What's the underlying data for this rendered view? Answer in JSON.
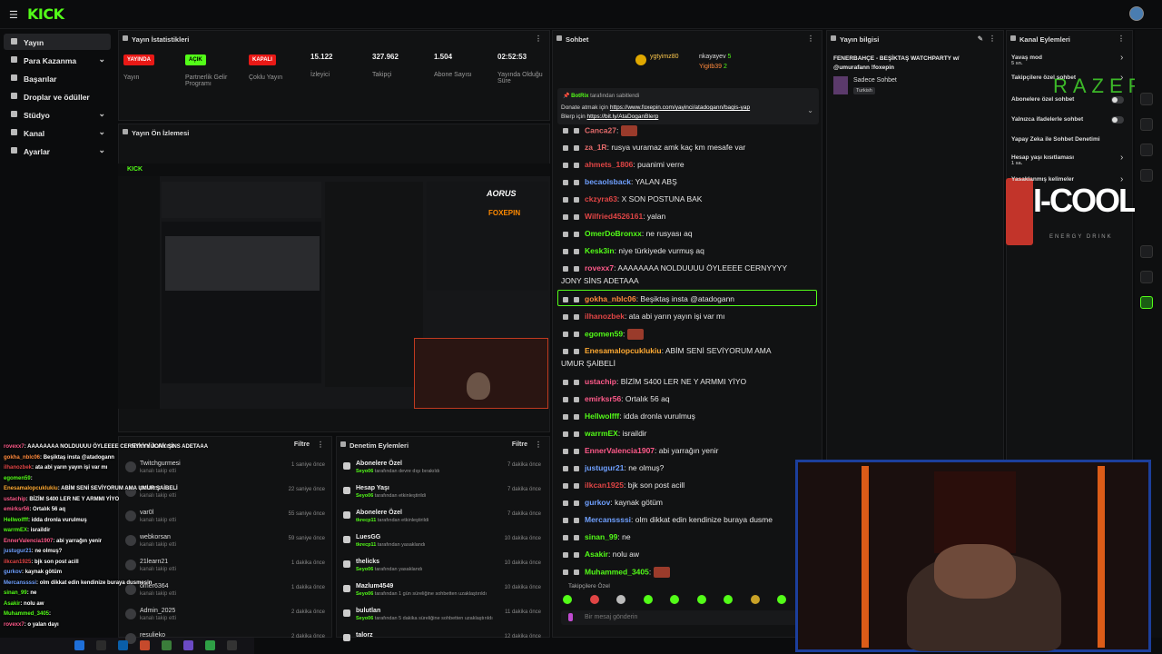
{
  "app": {
    "logo": "KICK",
    "brand_color": "#53fc18"
  },
  "sidebar": {
    "items": [
      {
        "label": "Yayın",
        "active": true,
        "chevron": ""
      },
      {
        "label": "Para Kazanma",
        "chevron": "⌄"
      },
      {
        "label": "Başarılar",
        "chevron": ""
      },
      {
        "label": "Droplar ve ödüller",
        "chevron": ""
      },
      {
        "label": "Stüdyo",
        "chevron": "⌄"
      },
      {
        "label": "Kanal",
        "chevron": "⌄"
      },
      {
        "label": "Ayarlar",
        "chevron": "⌄"
      }
    ]
  },
  "stats": {
    "title": "Yayın İstatistikleri",
    "items": [
      {
        "badge": "YAYINDA",
        "badge_color": "#e91916",
        "label": "Yayın"
      },
      {
        "badge": "AÇIK",
        "badge_color": "#53fc18",
        "label": "Partnerlik Gelir Programı"
      },
      {
        "badge": "KAPALI",
        "badge_color": "#e91916",
        "label": "Çoklu Yayın"
      },
      {
        "value": "15.122",
        "label": "İzleyici"
      },
      {
        "value": "327.962",
        "label": "Takipçi"
      },
      {
        "value": "1.504",
        "label": "Abone Sayısı"
      },
      {
        "value": "02:52:53",
        "label": "Yayında Olduğu Süre"
      }
    ]
  },
  "preview": {
    "title": "Yayın Ön İzlemesi"
  },
  "activity": {
    "title": "Etkinlik Akışı",
    "filter": "Filtre",
    "rows": [
      {
        "name": "Twitchgurmesi",
        "sub": "kanalı takip etti",
        "time": "1 saniye önce"
      },
      {
        "name": "polarez",
        "sub": "kanalı takip etti",
        "time": "22 saniye önce"
      },
      {
        "name": "var0l",
        "sub": "kanalı takip etti",
        "time": "55 saniye önce"
      },
      {
        "name": "webkorsan",
        "sub": "kanalı takip etti",
        "time": "59 saniye önce"
      },
      {
        "name": "21learn21",
        "sub": "kanalı takip etti",
        "time": "1 dakika önce"
      },
      {
        "name": "omer6364",
        "sub": "kanalı takip etti",
        "time": "1 dakika önce"
      },
      {
        "name": "Admin_2025",
        "sub": "kanalı takip etti",
        "time": "2 dakika önce"
      },
      {
        "name": "resulieko",
        "sub": "",
        "time": "2 dakika önce"
      }
    ]
  },
  "moderation": {
    "title": "Denetim Eylemleri",
    "filter": "Filtre",
    "rows": [
      {
        "name": "Abonelere Özel",
        "user": "Seyo06",
        "sub": "tarafından devre dışı bırakıldı",
        "time": "7 dakika önce"
      },
      {
        "name": "Hesap Yaşı",
        "user": "Seyo06",
        "sub": "tarafından etkinleştirildi",
        "time": "7 dakika önce"
      },
      {
        "name": "Abonelere Özel",
        "user": "tkrecp11",
        "sub": "tarafından etkinleştirildi",
        "time": "7 dakika önce"
      },
      {
        "name": "LuesGG",
        "user": "tkrecp11",
        "sub": "tarafından yasaklandı",
        "time": "10 dakika önce"
      },
      {
        "name": "thelicks",
        "user": "Seyo06",
        "sub": "tarafından yasaklandı",
        "time": "10 dakika önce"
      },
      {
        "name": "Mazlum4549",
        "user": "Seyo06",
        "sub": "tarafından 1 gün süreliğine sohbetten uzaklaştırıldı",
        "time": "10 dakika önce"
      },
      {
        "name": "bulutlan",
        "user": "Seyo06",
        "sub": "tarafından 5 dakika süreliğine sohbetten uzaklaştırıldı",
        "time": "11 dakika önce"
      },
      {
        "name": "talorz",
        "user": "",
        "sub": "",
        "time": "12 dakika önce"
      }
    ]
  },
  "chat": {
    "title": "Sohbet",
    "top_gifters": [
      {
        "name": "ygtyimz80",
        "count": ""
      },
      {
        "name": "nkayayev",
        "count": "5"
      },
      {
        "name": "Yigitb39",
        "count": "2"
      }
    ],
    "pinned": {
      "author": "BotRix",
      "by": "tarafından sabitlendi",
      "text1": "Donate atmak için",
      "link1": "https://www.foxepin.com/yayinci/atadogann/bagis-yap",
      "text2": "Blerp için",
      "link2": "https://bit.ly/AtaDoganBlerp"
    },
    "messages": [
      {
        "user": "Canca27",
        "color": "#e36b6b",
        "text": "",
        "emote": true
      },
      {
        "user": "za_1R",
        "color": "#e36b6b",
        "text": "rusya vuramaz amk kaç km mesafe var"
      },
      {
        "user": "ahmets_1806",
        "color": "#e04545",
        "text": "puanimi verre"
      },
      {
        "user": "becaolsback",
        "color": "#6fa0ff",
        "text": "YALAN ABŞ"
      },
      {
        "user": "ckzyra63",
        "color": "#e04545",
        "text": "X SON POSTUNA BAK"
      },
      {
        "user": "Wilfried4526161",
        "color": "#e04545",
        "text": "yalan"
      },
      {
        "user": "OmerDoBronxx",
        "color": "#53fc18",
        "text": "ne rusyası aq"
      },
      {
        "user": "Kesk3in",
        "color": "#53fc18",
        "text": "niye türkiyede vurmuş aq"
      },
      {
        "user": "rovexx7",
        "color": "#ff5a8a",
        "text": "AAAAAAAA NOLDUUUU ÖYLEEEE CERNYYYY"
      },
      {
        "user": "",
        "color": "#fff",
        "text": "JONY SİNS ADETAAA"
      },
      {
        "user": "gokha_nblc06",
        "color": "#ff8a3d",
        "text": "Beşiktaş insta @atadogann"
      },
      {
        "user": "ilhanozbek",
        "color": "#e04545",
        "text": "ata abi yarın yayın işi var mı"
      },
      {
        "user": "egomen59",
        "color": "#53fc18",
        "text": "",
        "emote": true
      },
      {
        "user": "Enesamalopcuklukiu",
        "color": "#ffaa33",
        "text": "ABİM SENİ SEVİYORUM AMA"
      },
      {
        "user": "",
        "color": "#fff",
        "text": "UMUR ŞAİBELİ"
      },
      {
        "user": "ustachip",
        "color": "#ff5a8a",
        "text": "BİZİM S400 LER NE Y ARMMI YİYO"
      },
      {
        "user": "emirksr56",
        "color": "#ff5a8a",
        "text": "Ortalık 56 aq"
      },
      {
        "user": "Hellwolfff",
        "color": "#53fc18",
        "text": "idda dronla vurulmuş"
      },
      {
        "user": "warrmEX",
        "color": "#53fc18",
        "text": "israildir"
      },
      {
        "user": "EnnerValencia1907",
        "color": "#ff5a8a",
        "text": "abi yarrağın yenir"
      },
      {
        "user": "justugur21",
        "color": "#6fa0ff",
        "text": "ne olmuş?"
      },
      {
        "user": "ilkcan1925",
        "color": "#e04545",
        "text": "bjk son post acill"
      },
      {
        "user": "gurkov",
        "color": "#6fa0ff",
        "text": "kaynak götüm"
      },
      {
        "user": "Mercanssssi",
        "color": "#6fa0ff",
        "text": "olm dikkat edin kendinize buraya dusme"
      },
      {
        "user": "sinan_99",
        "color": "#53fc18",
        "text": "ne"
      },
      {
        "user": "Asakir",
        "color": "#53fc18",
        "text": "nolu aw"
      },
      {
        "user": "Muhammed_3405",
        "color": "#53fc18",
        "text": "",
        "emote": true
      }
    ],
    "followers_only": "Takipçilere Özel",
    "input_placeholder": "Bir mesaj gönderin"
  },
  "stream_info": {
    "title": "Yayın bilgisi",
    "stream_title": "FENERBAHÇE - BEŞİKTAŞ WATCHPARTY w/ @umurafann !foxepin",
    "category": "Sadece Sohbet",
    "language": "Turkish"
  },
  "channel_actions": {
    "title": "Kanal Eylemleri",
    "items": [
      {
        "label": "Yavaş mod",
        "sub": "5 sn."
      },
      {
        "label": "Takipçilere özel sohbet",
        "sub": ""
      },
      {
        "label": "Abonelere özel sohbet",
        "sub": ""
      },
      {
        "label": "Yalnızca ifadelerle sohbet",
        "sub": ""
      },
      {
        "label": "Yapay Zeka ile Sohbet Denetimi",
        "sub": ""
      },
      {
        "label": "Hesap yaşı kısıtlaması",
        "sub": "1 sa."
      },
      {
        "label": "Yasaklanmış kelimeler",
        "sub": ""
      }
    ]
  },
  "sponsors": {
    "razer": "RAZER",
    "icool": "I-COOL",
    "icool_sub": "ENERGY DRINK",
    "aorus": "AORUS",
    "foxepin": "FOXEPIN"
  },
  "overlay_chat": [
    {
      "user": "rovexx7",
      "color": "#ff5a8a",
      "text": "AAAAAAAA NOLDUUUU ÖYLEEEE CERNYYYY JONY SİNS ADETAAA"
    },
    {
      "user": "gokha_nblc06",
      "color": "#ff8a3d",
      "text": "Beşiktaş insta @atadogann"
    },
    {
      "user": "ilhanozbek",
      "color": "#e04545",
      "text": "ata abi yarın yayın işi var mı"
    },
    {
      "user": "egomen59",
      "color": "#53fc18",
      "text": ""
    },
    {
      "user": "Enesamalopcuklukiu",
      "color": "#ffaa33",
      "text": "ABİM SENİ SEVİYORUM AMA UMUR ŞAİBELİ"
    },
    {
      "user": "ustachip",
      "color": "#ff5a8a",
      "text": "BİZİM S400 LER NE Y ARMMI YİYO"
    },
    {
      "user": "emirksr56",
      "color": "#ff5a8a",
      "text": "Ortalık 56 aq"
    },
    {
      "user": "Hellwolfff",
      "color": "#53fc18",
      "text": "idda dronla vurulmuş"
    },
    {
      "user": "warrmEX",
      "color": "#53fc18",
      "text": "israildir"
    },
    {
      "user": "EnnerValencia1907",
      "color": "#ff5a8a",
      "text": "abi yarrağın yenir"
    },
    {
      "user": "justugur21",
      "color": "#6fa0ff",
      "text": "ne olmuş?"
    },
    {
      "user": "ilkcan1925",
      "color": "#e04545",
      "text": "bjk son post acill"
    },
    {
      "user": "gurkov",
      "color": "#6fa0ff",
      "text": "kaynak götüm"
    },
    {
      "user": "Mercanssssi",
      "color": "#6fa0ff",
      "text": "olm dikkat edin kendinize buraya dusmesin"
    },
    {
      "user": "sinan_99",
      "color": "#53fc18",
      "text": "ne"
    },
    {
      "user": "Asakir",
      "color": "#53fc18",
      "text": "nolu aw"
    },
    {
      "user": "Muhammed_3405",
      "color": "#53fc18",
      "text": ""
    },
    {
      "user": "rovexx7",
      "color": "#ff5a8a",
      "text": "o yalan dayı"
    }
  ]
}
